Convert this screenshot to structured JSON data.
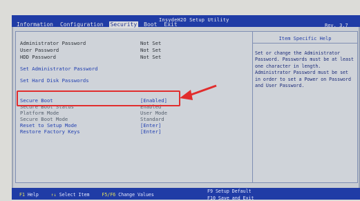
{
  "header": {
    "title": "InsydeH2O Setup Utility",
    "rev": "Rev. 3.7",
    "tabs": [
      {
        "label": "Information"
      },
      {
        "label": "Configuration"
      },
      {
        "label": "Security"
      },
      {
        "label": "Boot"
      },
      {
        "label": "Exit"
      }
    ]
  },
  "security": {
    "rows": [
      {
        "label": "Administrator Password",
        "value": "Not Set"
      },
      {
        "label": "User Password",
        "value": "Not Set"
      },
      {
        "label": "HDD Password",
        "value": "Not Set"
      },
      {
        "label": "Set Administrator Password",
        "value": ""
      },
      {
        "label": "Set Hard Disk Passwords",
        "value": ""
      },
      {
        "label": "Secure Boot",
        "value": "[Enabled]"
      },
      {
        "label": "Secure Boot Status",
        "value": "Enabled"
      },
      {
        "label": "Platform Mode",
        "value": "User Mode"
      },
      {
        "label": "Secure Boot Mode",
        "value": "Standard"
      },
      {
        "label": "Reset to Setup Mode",
        "value": "[Enter]"
      },
      {
        "label": "Restore Factory Keys",
        "value": "[Enter]"
      }
    ]
  },
  "help": {
    "title": "Item Specific Help",
    "text": "Set or change the Administrator Password. Passwords must be at least one character in length. Administrator Password must be set in order to set a Power on Password and User Password."
  },
  "footer": {
    "items": [
      {
        "key": "F1",
        "desc": "Help"
      },
      {
        "key": "↑↓",
        "desc": "Select Item"
      },
      {
        "key": "F5/F6",
        "desc": "Change Values"
      }
    ],
    "right1": {
      "key": "F9",
      "desc": "Setup Default"
    },
    "right2": {
      "key": "F10",
      "desc": "Save and Exit"
    }
  },
  "colors": {
    "accent": "#203ca6",
    "highlight": "#e12d2d"
  }
}
